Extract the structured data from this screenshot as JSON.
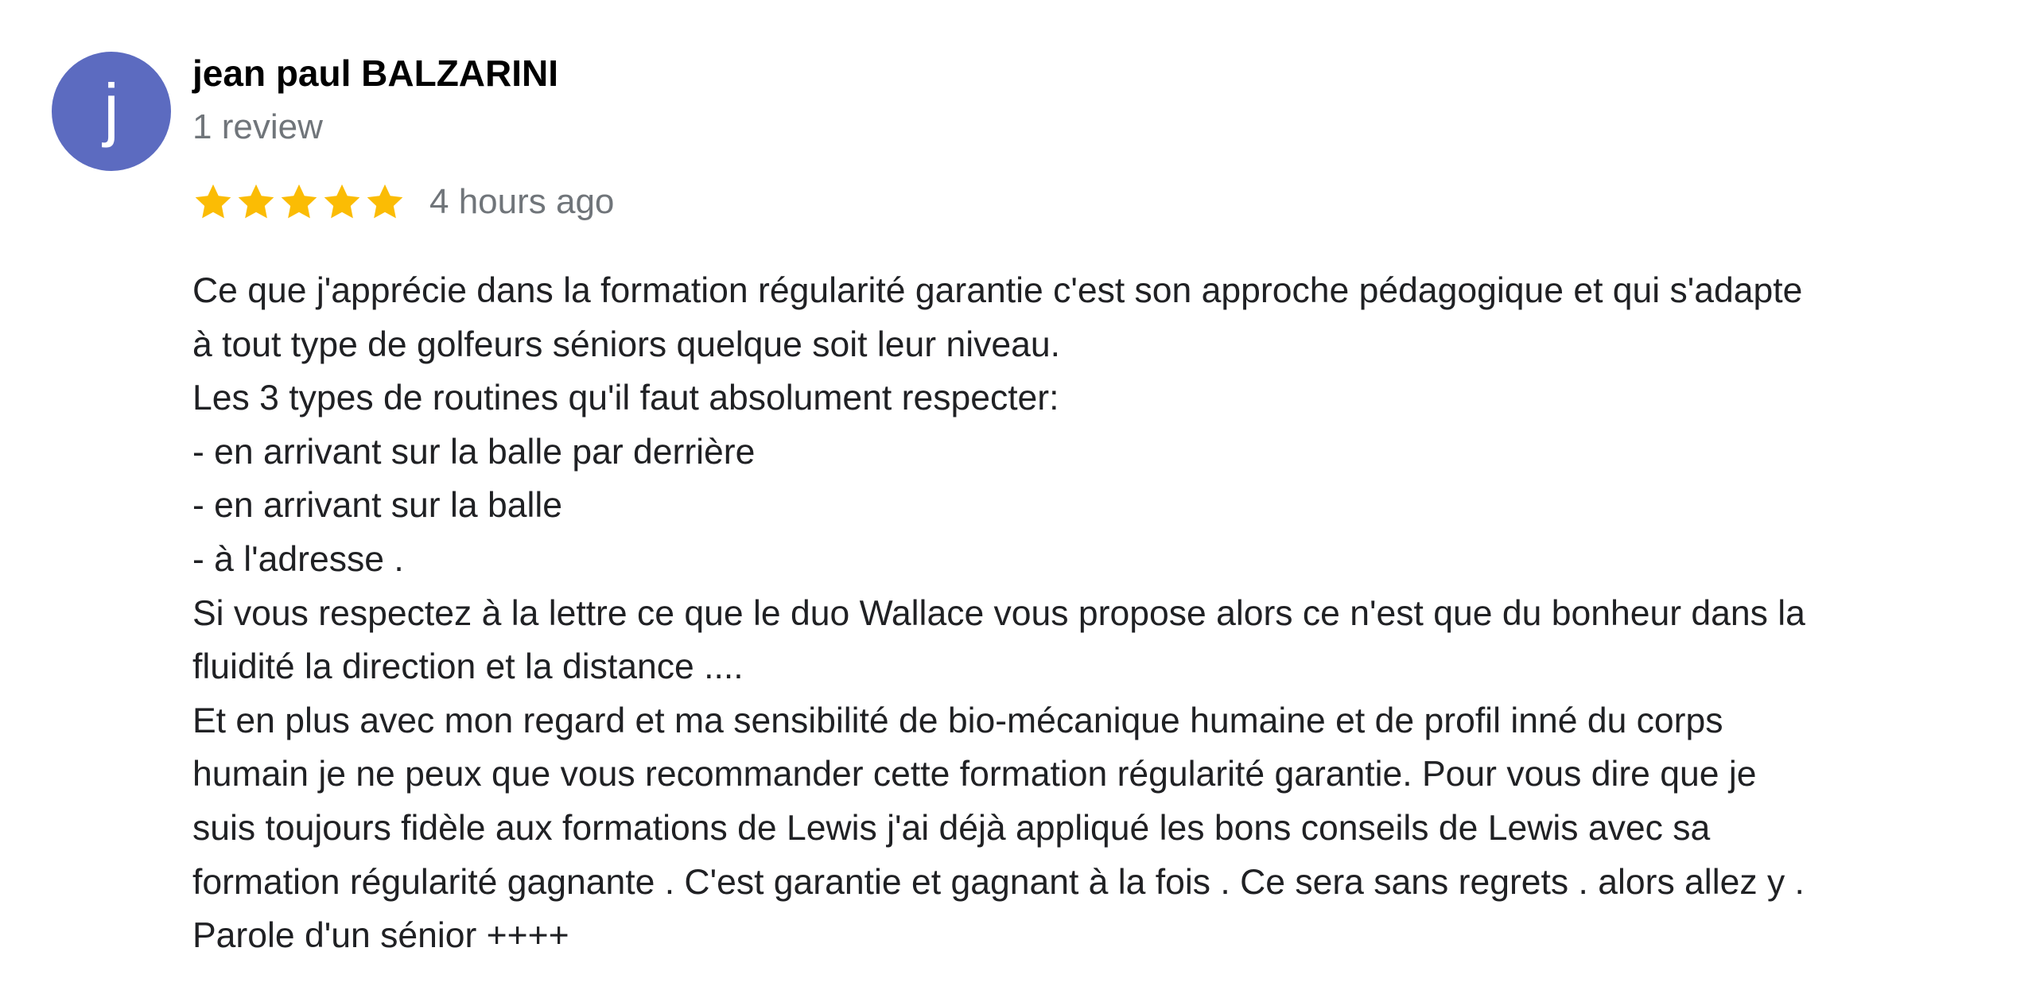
{
  "review": {
    "avatar_letter": "j",
    "avatar_color": "#5c6bc0",
    "author_name": "jean paul BALZARINI",
    "review_count": "1 review",
    "rating": 5,
    "rating_max": 5,
    "star_color": "#fbbc04",
    "star_icon": "star-icon",
    "timestamp": "4 hours ago",
    "text_lines": [
      "Ce que j'apprécie dans la formation régularité garantie c'est son approche pédagogique et qui s'adapte",
      "à tout type de golfeurs séniors quelque soit leur niveau.",
      "Les 3 types de routines qu'il faut absolument respecter:",
      "- en arrivant sur la balle par derrière",
      "- en arrivant sur la balle",
      "- à l'adresse .",
      "Si vous respectez à la lettre ce que le duo Wallace vous propose alors ce n'est que du bonheur dans la",
      "fluidité la direction et la distance ....",
      "Et en plus avec mon regard et ma sensibilité de bio-mécanique humaine et de profil inné du corps",
      "humain je ne peux que vous recommander cette formation régularité garantie.  Pour vous dire que je",
      "suis toujours fidèle aux formations de  Lewis j'ai déjà appliqué les bons conseils de Lewis avec sa",
      "formation régularité gagnante . C'est garantie et gagnant à la fois . Ce sera sans regrets . alors allez y .",
      "Parole d'un sénior ++++"
    ]
  }
}
